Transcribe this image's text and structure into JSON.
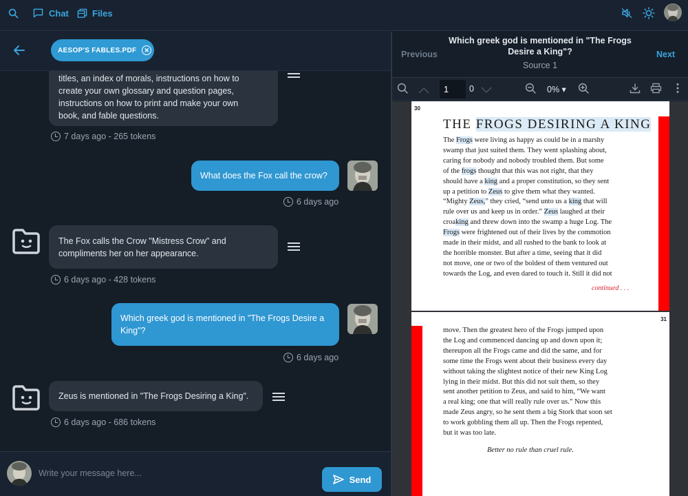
{
  "nav": {
    "chat_label": "Chat",
    "files_label": "Files",
    "icons": [
      "search-icon",
      "chat-icon",
      "files-icon",
      "mute-icon",
      "sun-icon"
    ]
  },
  "chat": {
    "file_chip": "AESOP'S FABLES.PDF",
    "messages": [
      {
        "role": "bot",
        "text_lines": [
          "titles, an index of morals, instructions on how to",
          "create your own glossary and question pages,",
          "instructions on how to print and make your own",
          "book, and fable questions."
        ],
        "meta": "7 days ago - 265 tokens"
      },
      {
        "role": "user",
        "text": "What does the Fox call the crow?",
        "meta": "6 days ago"
      },
      {
        "role": "bot",
        "text_lines": [
          "The Fox calls the Crow \"Mistress Crow\" and",
          "compliments her on her appearance."
        ],
        "meta": "6 days ago - 428 tokens"
      },
      {
        "role": "user",
        "text_lines": [
          "Which greek god is mentioned in \"The Frogs Desire a",
          "King\"?"
        ],
        "meta": "6 days ago"
      },
      {
        "role": "bot",
        "text": "Zeus is mentioned in \"The Frogs Desiring a King\".",
        "meta": "6 days ago - 686 tokens"
      }
    ],
    "composer_placeholder": "Write your message here...",
    "send_label": "Send"
  },
  "source": {
    "prev_label": "Previous",
    "next_label": "Next",
    "question_lines": [
      "Which greek god is mentioned in \"The Frogs",
      "Desire a King\"?"
    ],
    "source_label": "Source 1",
    "page_value": "1",
    "page_total": "0",
    "zoom": "0%"
  },
  "pdf": {
    "page1_number": "30",
    "page2_number": "31",
    "title_pre": "THE ",
    "title_hl": "FROGS DESIRING A KING",
    "continued": "continued . . .",
    "moral": "Better no rule than cruel rule."
  }
}
